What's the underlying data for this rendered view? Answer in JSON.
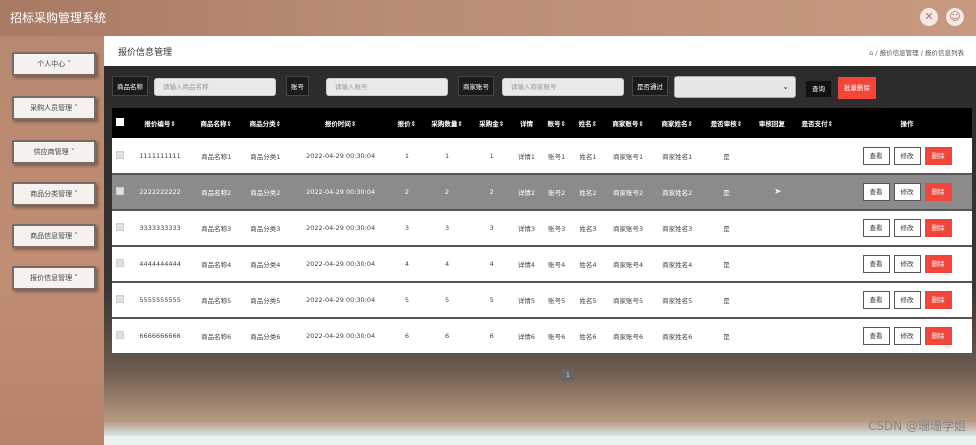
{
  "app": {
    "title": "招标采购管理系统"
  },
  "top_icons": [
    {
      "name": "fullscreen-icon",
      "glyph": "✕"
    },
    {
      "name": "user-icon",
      "glyph": "☺"
    }
  ],
  "sidebar": {
    "items": [
      {
        "label": "个人中心 ˅"
      },
      {
        "label": "采购人员管理 ˅"
      },
      {
        "label": "供应商管理 ˅"
      },
      {
        "label": "商品分类管理 ˅"
      },
      {
        "label": "商品信息管理 ˅"
      },
      {
        "label": "报价信息管理 ˅"
      }
    ]
  },
  "page": {
    "title": "报价信息管理",
    "breadcrumb": "⌂ / 报价信息管理 / 报价信息列表"
  },
  "filters": {
    "product_name_label": "商品名称",
    "product_name_placeholder": "请输入商品名称",
    "account_label": "账号",
    "account_placeholder": "请输入账号",
    "merchant_label": "商家账号",
    "merchant_placeholder": "请输入商家账号",
    "passed_label": "是否通过",
    "search_button": "查询",
    "bulk_delete_button": "批量删除"
  },
  "table": {
    "headers": [
      "报价编号⇕",
      "商品名称⇕",
      "商品分类⇕",
      "报价时间⇕",
      "报价⇕",
      "采购数量⇕",
      "采购金⇕",
      "详情",
      "账号⇕",
      "姓名⇕",
      "商家账号⇕",
      "商家姓名⇕",
      "是否审核⇕",
      "审核回复",
      "是否支付⇕",
      "操作"
    ],
    "rows": [
      [
        "1111111111",
        "商品名称1",
        "商品分类1",
        "2022-04-29 00:30:04",
        "1",
        "1",
        "1",
        "详情1",
        "账号1",
        "姓名1",
        "商家账号1",
        "商家姓名1",
        "是",
        "",
        ""
      ],
      [
        "2222222222",
        "商品名称2",
        "商品分类2",
        "2022-04-29 00:30:04",
        "2",
        "2",
        "2",
        "详情2",
        "账号2",
        "姓名2",
        "商家账号2",
        "商家姓名2",
        "是",
        "",
        ""
      ],
      [
        "3333333333",
        "商品名称3",
        "商品分类3",
        "2022-04-29 00:30:04",
        "3",
        "3",
        "3",
        "详情3",
        "账号3",
        "姓名3",
        "商家账号3",
        "商家姓名3",
        "是",
        "",
        ""
      ],
      [
        "4444444444",
        "商品名称4",
        "商品分类4",
        "2022-04-29 00:30:04",
        "4",
        "4",
        "4",
        "详情4",
        "账号4",
        "姓名4",
        "商家账号4",
        "商家姓名4",
        "是",
        "",
        ""
      ],
      [
        "5555555555",
        "商品名称5",
        "商品分类5",
        "2022-04-29 00:30:04",
        "5",
        "5",
        "5",
        "详情5",
        "账号5",
        "姓名5",
        "商家账号5",
        "商家姓名5",
        "是",
        "",
        ""
      ],
      [
        "6666666666",
        "商品名称6",
        "商品分类6",
        "2022-04-29 00:30:04",
        "6",
        "6",
        "6",
        "详情6",
        "账号6",
        "姓名6",
        "商家账号6",
        "商家姓名6",
        "是",
        "",
        ""
      ]
    ],
    "actions": {
      "view": "查看",
      "edit": "修改",
      "delete": "删除"
    },
    "selected_row": 1
  },
  "pager": {
    "current": "1"
  },
  "watermark": "CSDN @珊珊学姐"
}
